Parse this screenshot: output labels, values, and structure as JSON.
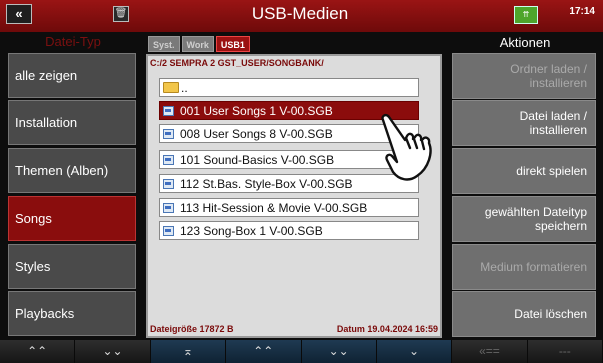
{
  "topbar": {
    "back_glyph": "«",
    "trash_glyph": "🗑",
    "title": "USB-Medien",
    "usb_glyph": "⇈",
    "time": "17:14"
  },
  "left": {
    "title": "Datei-Typ",
    "items": [
      {
        "label": "alle zeigen",
        "active": false
      },
      {
        "label": "Installation",
        "active": false
      },
      {
        "label": "Themen (Alben)",
        "active": false
      },
      {
        "label": "Songs",
        "active": true
      },
      {
        "label": "Styles",
        "active": false
      },
      {
        "label": "Playbacks",
        "active": false
      }
    ]
  },
  "tabs": [
    {
      "label": "Syst.",
      "active": false
    },
    {
      "label": "Work",
      "active": false
    },
    {
      "label": "USB1",
      "active": true
    }
  ],
  "browser": {
    "path": "C:/2 SEMPRA 2 GST_USER/SONGBANK/",
    "parent_label": "..",
    "files": [
      {
        "label": "001 User Songs 1 V-00.SGB",
        "selected": true
      },
      {
        "label": "008 User Songs 8 V-00.SGB",
        "selected": false
      },
      {
        "label": "101 Sound-Basics V-00.SGB",
        "selected": false
      },
      {
        "label": "112 St.Bas. Style-Box V-00.SGB",
        "selected": false
      },
      {
        "label": "113 Hit-Session & Movie V-00.SGB",
        "selected": false
      },
      {
        "label": "123 Song-Box 1 V-00.SGB",
        "selected": false
      }
    ],
    "status_size": "Dateigröße 17872 B",
    "status_date": "Datum 19.04.2024 16:59"
  },
  "right": {
    "title": "Aktionen",
    "buttons": [
      {
        "line1": "Ordner laden /",
        "line2": "installieren",
        "enabled": false
      },
      {
        "line1": "Datei laden /",
        "line2": "installieren",
        "enabled": true
      },
      {
        "line1": "direkt spielen",
        "line2": "",
        "enabled": true
      },
      {
        "line1": "gewählten Dateityp",
        "line2": "speichern",
        "enabled": true
      },
      {
        "line1": "Medium formatieren",
        "line2": "",
        "enabled": false
      },
      {
        "line1": "Datei löschen",
        "line2": "",
        "enabled": true
      }
    ]
  },
  "bottombar": [
    {
      "glyph": "⌃⌃",
      "enabled": true
    },
    {
      "glyph": "⌄⌄",
      "enabled": true
    },
    {
      "glyph": "⌅",
      "enabled": true
    },
    {
      "glyph": "⌃⌃",
      "enabled": true
    },
    {
      "glyph": "⌄⌄",
      "enabled": true
    },
    {
      "glyph": "⌄",
      "enabled": true
    },
    {
      "glyph": "«==",
      "enabled": false
    },
    {
      "glyph": "---",
      "enabled": false
    }
  ]
}
